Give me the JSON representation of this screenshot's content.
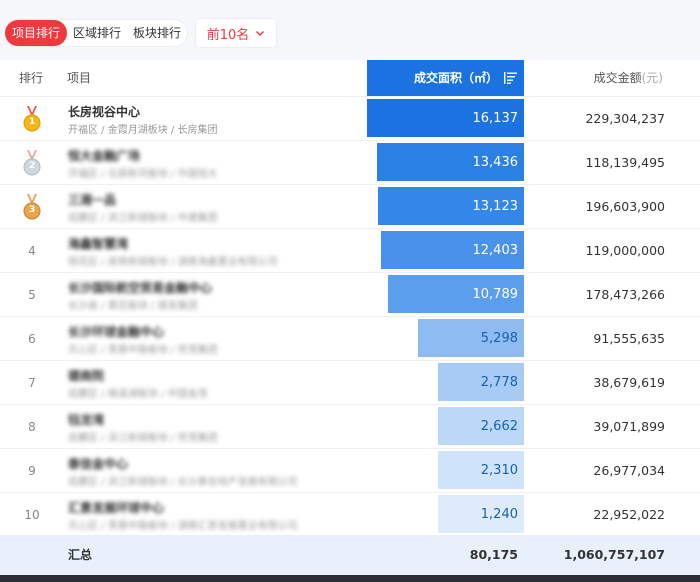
{
  "tabs": {
    "items": [
      "项目排行",
      "区域排行",
      "板块排行"
    ],
    "active": 0
  },
  "filter": {
    "top_label": "前10名"
  },
  "header": {
    "rank": "排行",
    "project": "项目",
    "area": "成交面积（㎡）",
    "amount": "成交金额",
    "amount_unit": "(元)"
  },
  "rows": [
    {
      "rank": "1",
      "name": "长房视谷中心",
      "sub": "开福区 / 金霞月湖板块 / 长房集团",
      "area": "16,137",
      "amount": "229,304,237",
      "area_value": 16137,
      "blurred": false
    },
    {
      "rank": "2",
      "name": "恒大金融广场",
      "sub": "开福区 / 北辰新河板块 / 中国恒大",
      "area": "13,436",
      "amount": "118,139,495",
      "area_value": 13436,
      "blurred": true
    },
    {
      "rank": "3",
      "name": "三湘一品",
      "sub": "岳麓区 / 滨江新城板块 / 中建集团",
      "area": "13,123",
      "amount": "196,603,900",
      "area_value": 13123,
      "blurred": true
    },
    {
      "rank": "4",
      "name": "海鑫智慧湾",
      "sub": "雨花区 / 高铁新城板块 / 湖南海鑫置业有限公司",
      "area": "12,403",
      "amount": "119,000,000",
      "area_value": 12403,
      "blurred": true
    },
    {
      "rank": "5",
      "name": "长沙国际航空贸易金融中心",
      "sub": "长沙县 / 黄花板块 / 城发集团",
      "area": "10,789",
      "amount": "178,473,266",
      "area_value": 10789,
      "blurred": true
    },
    {
      "rank": "6",
      "name": "长沙环球金融中心",
      "sub": "天心区 / 芙蓉中路板块 / 世茂集团",
      "area": "5,298",
      "amount": "91,555,635",
      "area_value": 5298,
      "blurred": true
    },
    {
      "rank": "7",
      "name": "德商院",
      "sub": "岳麓区 / 梅溪湖板块 / 中国金茂",
      "area": "2,778",
      "amount": "38,679,619",
      "area_value": 2778,
      "blurred": true
    },
    {
      "rank": "8",
      "name": "钰龙湾",
      "sub": "岳麓区 / 滨江新城板块 / 世茂集团",
      "area": "2,662",
      "amount": "39,071,899",
      "area_value": 2662,
      "blurred": true
    },
    {
      "rank": "9",
      "name": "泰信金中心",
      "sub": "岳麓区 / 滨江新城板块 / 长沙泰信地产发展有限公司",
      "area": "2,310",
      "amount": "26,977,034",
      "area_value": 2310,
      "blurred": true
    },
    {
      "rank": "10",
      "name": "汇景发展环球中心",
      "sub": "天心区 / 芙蓉中路板块 / 湖南汇景发展置业有限公司",
      "area": "1,240",
      "amount": "22,952,022",
      "area_value": 1240,
      "blurred": true
    }
  ],
  "total": {
    "label": "汇总",
    "area": "80,175",
    "amount": "1,060,757,107"
  },
  "colors": {
    "accent_red": "#f0383f",
    "header_blue": "#1a73e0",
    "bar_colors": [
      "#1a73e0",
      "#2b80e6",
      "#3387e8",
      "#4892eb",
      "#5c9eee",
      "#8ebcf2",
      "#a7cbf5",
      "#bcd8f8",
      "#cfe3fa",
      "#deebfb"
    ]
  }
}
